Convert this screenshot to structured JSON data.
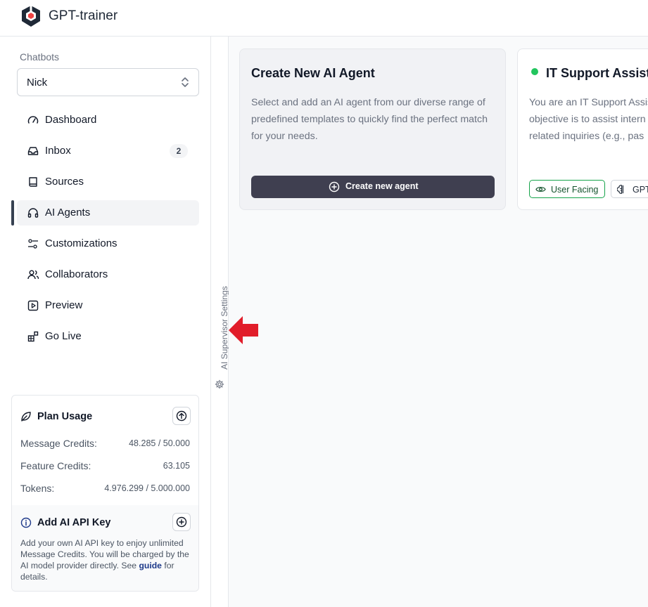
{
  "app": {
    "brand": "GPT-trainer"
  },
  "sidebar": {
    "section_label": "Chatbots",
    "chatbot_select": {
      "value": "Nick"
    },
    "items": [
      {
        "label": "Dashboard",
        "icon": "gauge-icon"
      },
      {
        "label": "Inbox",
        "icon": "inbox-icon",
        "badge": "2"
      },
      {
        "label": "Sources",
        "icon": "book-icon"
      },
      {
        "label": "AI Agents",
        "icon": "headphones-icon",
        "active": true
      },
      {
        "label": "Customizations",
        "icon": "sliders-icon"
      },
      {
        "label": "Collaborators",
        "icon": "users-icon"
      },
      {
        "label": "Preview",
        "icon": "play-square-icon"
      },
      {
        "label": "Go Live",
        "icon": "blocks-icon"
      }
    ],
    "plan_usage": {
      "title": "Plan Usage",
      "rows": [
        {
          "label": "Message Credits:",
          "value": "48.285 / 50.000"
        },
        {
          "label": "Feature Credits:",
          "value": "63.105"
        },
        {
          "label": "Tokens:",
          "value": "4.976.299 / 5.000.000"
        }
      ],
      "api_key": {
        "title": "Add AI API Key",
        "desc_before": "Add your own AI API key to enjoy unlimited Message Credits. You will be charged by the AI model provider directly. See ",
        "link": "guide",
        "desc_after": " for details."
      }
    }
  },
  "supervisor": {
    "label": "AI Supervisor Settings"
  },
  "main": {
    "create_card": {
      "title": "Create New AI Agent",
      "description": "Select and add an AI agent from our diverse range of predefined templates to quickly find the perfect match for your needs.",
      "button_label": "Create new agent"
    },
    "agent_card": {
      "title": "IT Support Assista",
      "desc_lines": [
        "You are an IT Support Assis",
        "objective is to assist intern",
        "related inquiries (e.g., pas"
      ],
      "tags": [
        {
          "label": "User Facing",
          "icon": "eye-icon"
        },
        {
          "label": "GPT",
          "icon": "brain-icon"
        }
      ]
    }
  },
  "colors": {
    "accent_dark": "#3f3f50",
    "status_green": "#22c55e",
    "arrow_red": "#e11d2a"
  }
}
